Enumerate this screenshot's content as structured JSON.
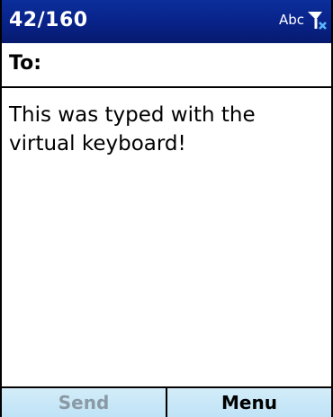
{
  "titlebar": {
    "char_count": "42/160",
    "input_mode": "Abc",
    "signal_icon": "antenna-no-signal-icon",
    "background_color": "#09238a"
  },
  "to_field": {
    "label": "To:",
    "value": ""
  },
  "message": {
    "body": "This was typed with the virtual keyboard!"
  },
  "softkeys": {
    "left_label": "Send",
    "right_label": "Menu",
    "left_enabled": false,
    "background_color": "#c9e8f8"
  }
}
